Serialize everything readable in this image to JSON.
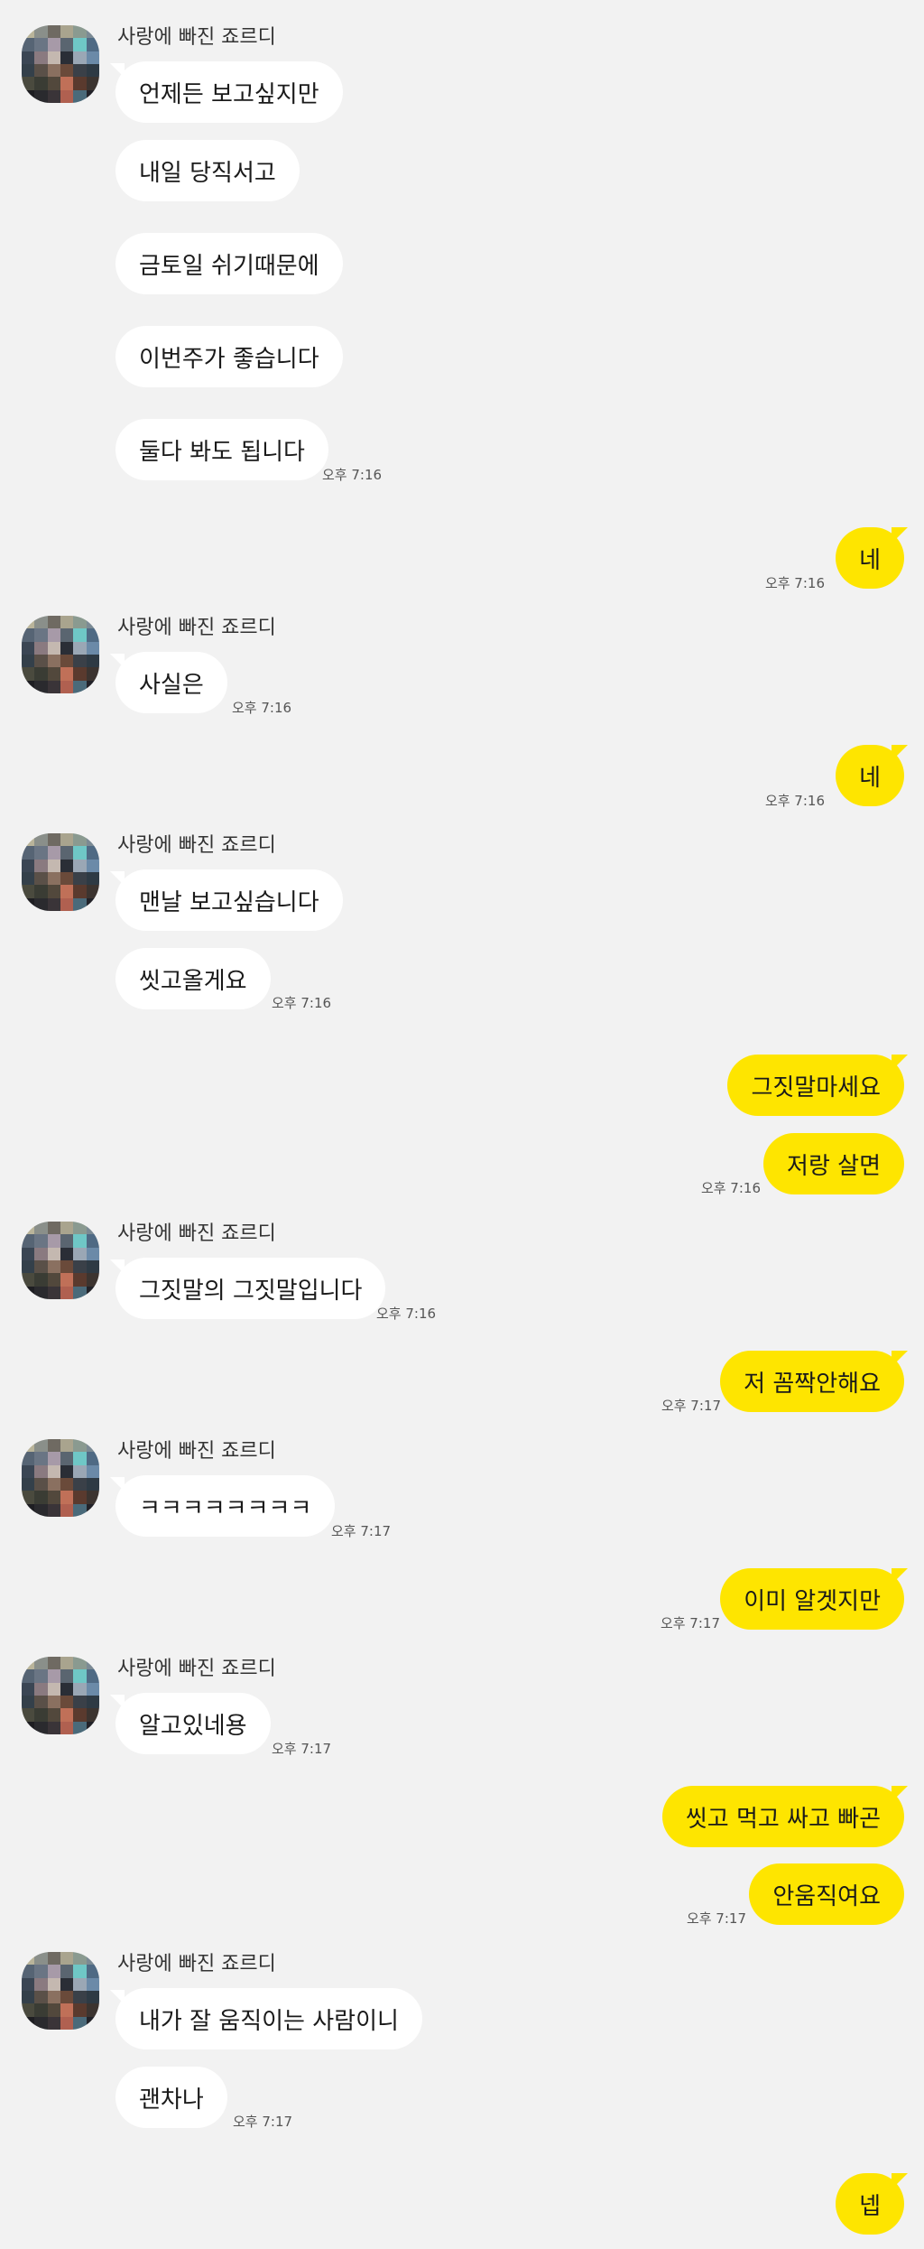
{
  "contact": {
    "name": "사랑에 빠진 죠르디"
  },
  "messages": {
    "m1": "언제든 보고싶지만",
    "m2": "내일 당직서고",
    "m3": "금토일 쉬기때문에",
    "m4": "이번주가 좋습니다",
    "m5": "둘다 봐도 됩니다",
    "m6": "네",
    "m7": "사실은",
    "m8": "네",
    "m9": "맨날 보고싶습니다",
    "m10": "씻고올게요",
    "m11": "그짓말마세요",
    "m12": "저랑 살면",
    "m13": "그짓말의 그짓말입니다",
    "m14": "저 꼼짝안해요",
    "m15": "ㅋㅋㅋㅋㅋㅋㅋㅋ",
    "m16": "이미 알겟지만",
    "m17": "알고있네용",
    "m18": "씻고 먹고 싸고 빠곤",
    "m19": "안움직여요",
    "m20": "내가 잘 움직이는 사람이니",
    "m21": "괜차나",
    "m22": "넵"
  },
  "times": {
    "t1": "오후 7:16",
    "t2": "오후 7:16",
    "t3": "오후 7:16",
    "t4": "오후 7:16",
    "t5": "오후 7:16",
    "t6": "오후 7:16",
    "t7": "오후 7:16",
    "t8": "오후 7:17",
    "t9": "오후 7:17",
    "t10": "오후 7:17",
    "t11": "오후 7:17",
    "t12": "오후 7:17",
    "t13": "오후 7:17"
  },
  "colors": {
    "background": "#f2f2f2",
    "incoming_bubble": "#ffffff",
    "outgoing_bubble": "#fee500"
  }
}
